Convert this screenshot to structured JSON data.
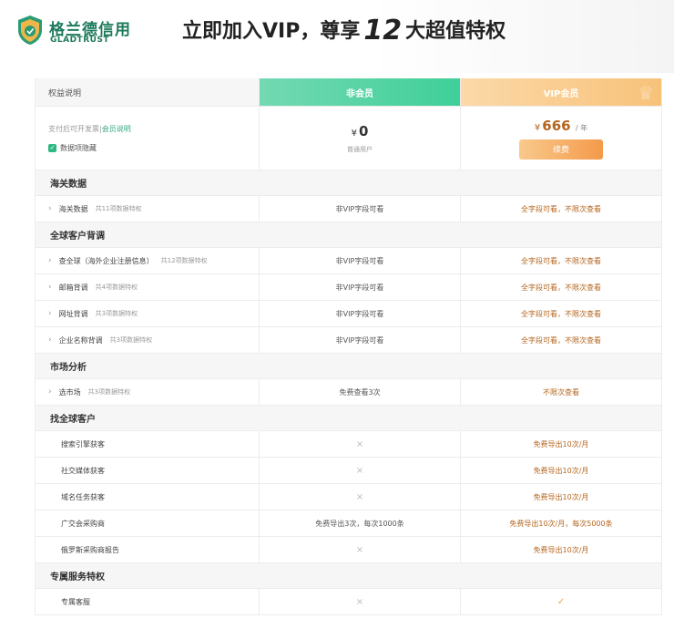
{
  "brand": {
    "name_cn": "格兰德信用",
    "name_en": "GLADTRUST"
  },
  "hero": {
    "pre": "立即加入VIP，尊享",
    "number": "12",
    "post": "大超值特权"
  },
  "table": {
    "header": {
      "benefit": "权益说明",
      "free": "非会员",
      "vip": "VIP会员"
    },
    "price": {
      "note": "支付后可开发票",
      "link": "会员说明",
      "checkbox_label": "数据项隐藏",
      "free_yen": "¥",
      "free_price": "0",
      "free_sub": "普通用户",
      "vip_yen": "¥",
      "vip_price": "666",
      "vip_unit": "/ 年",
      "renew": "续费"
    },
    "sections": [
      {
        "title": "海关数据"
      },
      {
        "title": "全球客户背调"
      },
      {
        "title": "市场分析"
      },
      {
        "title": "找全球客户"
      },
      {
        "title": "专属服务特权"
      }
    ],
    "rows": [
      {
        "name": "海关数据",
        "count": "共11项数据特权",
        "free": "非VIP字段可看",
        "vip": "全字段可看，不限次查看"
      },
      {
        "name": "查全球（海外企业注册信息）",
        "count": "共12项数据特权",
        "free": "非VIP字段可看",
        "vip": "全字段可看，不限次查看"
      },
      {
        "name": "邮箱背调",
        "count": "共4项数据特权",
        "free": "非VIP字段可看",
        "vip": "全字段可看，不限次查看"
      },
      {
        "name": "网址背调",
        "count": "共3项数据特权",
        "free": "非VIP字段可看",
        "vip": "全字段可看，不限次查看"
      },
      {
        "name": "企业名称背调",
        "count": "共3项数据特权",
        "free": "非VIP字段可看",
        "vip": "全字段可看，不限次查看"
      },
      {
        "name": "选市场",
        "count": "共3项数据特权",
        "free": "免费查看3次",
        "vip": "不限次查看"
      },
      {
        "name": "搜索引擎获客",
        "free": "×",
        "vip": "免费导出10次/月"
      },
      {
        "name": "社交媒体获客",
        "free": "×",
        "vip": "免费导出10次/月"
      },
      {
        "name": "域名任务获客",
        "free": "×",
        "vip": "免费导出10次/月"
      },
      {
        "name": "广交会采购商",
        "free": "免费导出3次，每次1000条",
        "vip": "免费导出10次/月，每次5000条"
      },
      {
        "name": "俄罗斯采购商报告",
        "free": "×",
        "vip": "免费导出10次/月"
      },
      {
        "name": "专属客服",
        "free": "×",
        "vip": "✓"
      }
    ]
  },
  "colors": {
    "free_header": "#3fcf98",
    "vip_header": "#f8c27a",
    "vip_text": "#b5651d",
    "brand": "#1d7a5c"
  },
  "icons": {
    "logo": "shield-logo-icon",
    "chevron": "chevron-right-icon",
    "cross": "cross-icon",
    "check": "check-icon"
  }
}
